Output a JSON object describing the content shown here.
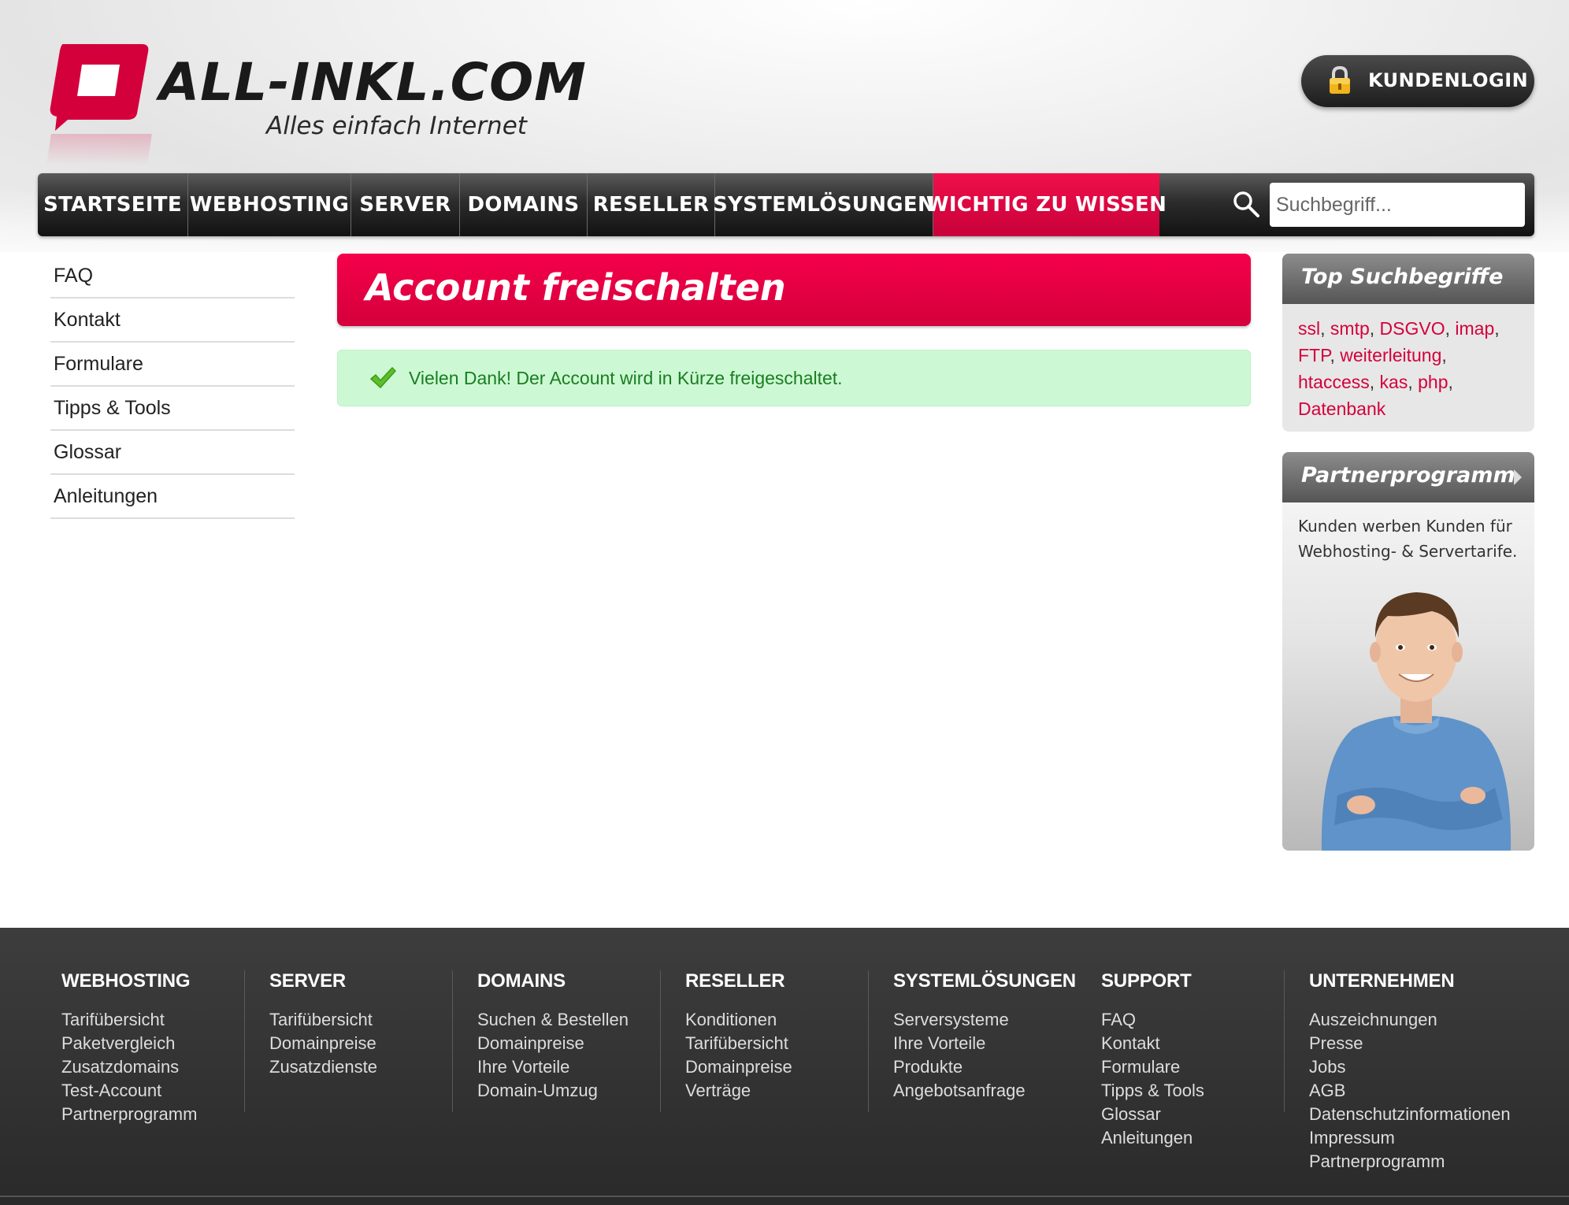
{
  "logo": {
    "name": "ALL-INKL.COM",
    "tagline": "Alles einfach Internet"
  },
  "header": {
    "login_label": "KUNDENLOGIN"
  },
  "nav": {
    "items": [
      {
        "label": "STARTSEITE"
      },
      {
        "label": "WEBHOSTING"
      },
      {
        "label": "SERVER"
      },
      {
        "label": "DOMAINS"
      },
      {
        "label": "RESELLER"
      },
      {
        "label": "SYSTEMLÖSUNGEN"
      },
      {
        "label": "WICHTIG ZU WISSEN",
        "active": true
      }
    ],
    "search_placeholder": "Suchbegriff..."
  },
  "sidebar": {
    "items": [
      {
        "label": "FAQ"
      },
      {
        "label": "Kontakt"
      },
      {
        "label": "Formulare"
      },
      {
        "label": "Tipps & Tools"
      },
      {
        "label": "Glossar"
      },
      {
        "label": "Anleitungen"
      }
    ]
  },
  "main": {
    "title": "Account freischalten",
    "success_message": "Vielen Dank! Der Account wird in Kürze freigeschaltet."
  },
  "top_terms": {
    "title": "Top Suchbegriffe",
    "terms": [
      "ssl",
      "smtp",
      "DSGVO",
      "imap",
      "FTP",
      "weiterleitung",
      "htaccess",
      "kas",
      "php",
      "Datenbank"
    ]
  },
  "partner": {
    "title": "Partnerprogramm",
    "text": "Kunden werben Kunden für Webhosting- & Servertarife."
  },
  "footer": {
    "columns": [
      {
        "heading": "WEBHOSTING",
        "links": [
          "Tarifübersicht",
          "Paketvergleich",
          "Zusatzdomains",
          "Test-Account",
          "Partnerprogramm"
        ]
      },
      {
        "heading": "SERVER",
        "links": [
          "Tarifübersicht",
          "Domainpreise",
          "Zusatzdienste"
        ]
      },
      {
        "heading": "DOMAINS",
        "links": [
          "Suchen & Bestellen",
          "Domainpreise",
          "Ihre Vorteile",
          "Domain-Umzug"
        ]
      },
      {
        "heading": "RESELLER",
        "links": [
          "Konditionen",
          "Tarifübersicht",
          "Domainpreise",
          "Verträge"
        ]
      },
      {
        "heading": "SYSTEMLÖSUNGEN",
        "links": [
          "Serversysteme",
          "Ihre Vorteile",
          "Produkte",
          "Angebotsanfrage"
        ]
      },
      {
        "heading": "SUPPORT",
        "links": [
          "FAQ",
          "Kontakt",
          "Formulare",
          "Tipps & Tools",
          "Glossar",
          "Anleitungen"
        ]
      },
      {
        "heading": "UNTERNEHMEN",
        "links": [
          "Auszeichnungen",
          "Presse",
          "Jobs",
          "AGB",
          "Datenschutzinformationen",
          "Impressum",
          "Partnerprogramm"
        ]
      }
    ]
  },
  "colors": {
    "brand_red": "#d4003b",
    "nav_dark": "#1d1d1d",
    "success_bg": "#ccf9d4",
    "success_text": "#1b7d21"
  }
}
